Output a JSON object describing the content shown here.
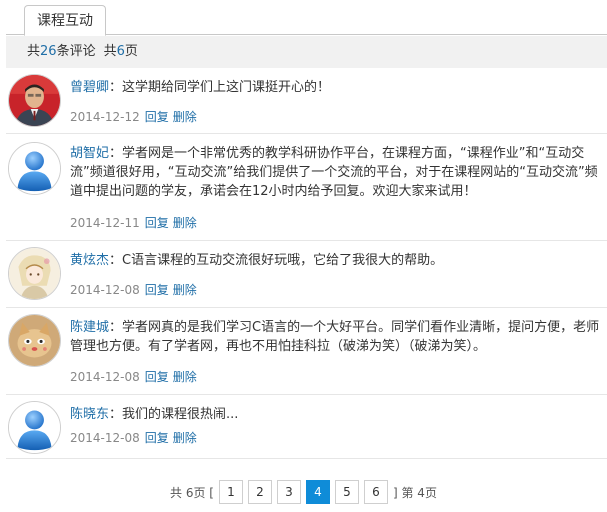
{
  "tab": {
    "label": "课程互动"
  },
  "summary": {
    "prefix": "共",
    "comment_count": "26",
    "comment_suffix": "条评论",
    "page_prefix": "共",
    "page_count": "6",
    "page_suffix": "页"
  },
  "actions": {
    "reply": "回复",
    "delete": "删除"
  },
  "comments": [
    {
      "author": "曾碧卿",
      "text": "这学期给同学们上这门课挺开心的！",
      "date": "2014-12-12",
      "avatar": "photo-man-icon"
    },
    {
      "author": "胡智妃",
      "text": "学者网是一个非常优秀的教学科研协作平台，在课程方面，“课程作业”和“互动交流”频道很好用，“互动交流”给我们提供了一个交流的平台，对于在课程网站的“互动交流”频道中提出问题的学友，承诺会在12小时内给予回复。欢迎大家来试用！",
      "date": "2014-12-11",
      "avatar": "default-user-icon"
    },
    {
      "author": "黄炫杰",
      "text": "C语言课程的互动交流很好玩哦，它给了我很大的帮助。",
      "date": "2014-12-08",
      "avatar": "anime-sketch-icon"
    },
    {
      "author": "陈建城",
      "text": "学者网真的是我们学习C语言的一个大好平台。同学们看作业清晰，提问方便，老师管理也方便。有了学者网，再也不用怕挂科拉（破涕为笑）（破涕为笑）。",
      "date": "2014-12-08",
      "avatar": "cat-photo-icon"
    },
    {
      "author": "陈晓东",
      "text": "我们的课程很热闹...",
      "date": "2014-12-08",
      "avatar": "default-user-icon"
    }
  ],
  "pager": {
    "prefix": "共 6页 [",
    "pages": [
      "1",
      "2",
      "3",
      "4",
      "5",
      "6"
    ],
    "current": "4",
    "suffix": "] 第 4页"
  },
  "colors": {
    "link": "#1f6ea7",
    "active_page": "#0f8cd8"
  }
}
